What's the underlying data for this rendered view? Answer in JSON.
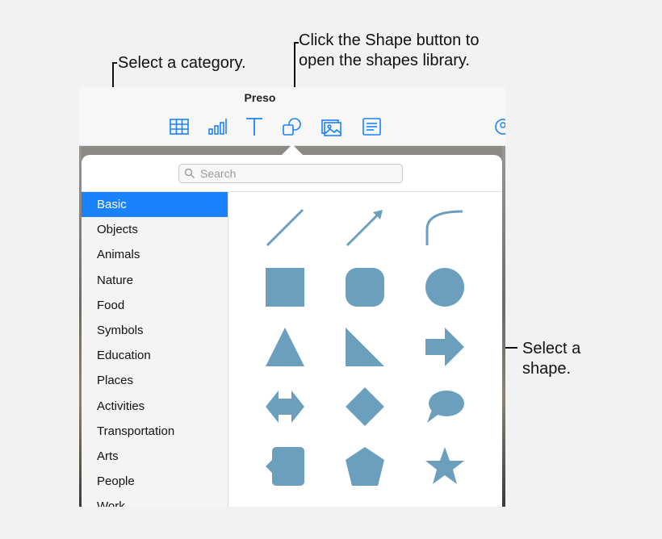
{
  "callouts": {
    "category": "Select a category.",
    "shape_button": "Click the Shape button to\nopen the shapes library.",
    "shape": "Select a\nshape."
  },
  "window": {
    "title": "Preso"
  },
  "toolbar": {
    "icons": [
      "table-icon",
      "chart-icon",
      "text-icon",
      "shape-icon",
      "media-icon",
      "comment-icon"
    ]
  },
  "library": {
    "search_placeholder": "Search",
    "categories": [
      "Basic",
      "Objects",
      "Animals",
      "Nature",
      "Food",
      "Symbols",
      "Education",
      "Places",
      "Activities",
      "Transportation",
      "Arts",
      "People",
      "Work"
    ],
    "selected_category": "Basic",
    "shapes": [
      "line",
      "arrow-line",
      "curve",
      "square",
      "rounded-square",
      "circle",
      "triangle",
      "right-triangle",
      "arrow",
      "double-arrow",
      "diamond",
      "speech-bubble",
      "callout-square",
      "pentagon",
      "star"
    ],
    "shape_color": "#6b9fbd",
    "accent_color": "#1a82fb"
  }
}
